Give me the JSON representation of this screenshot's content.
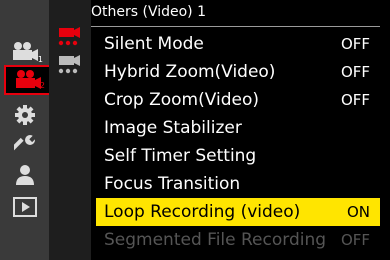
{
  "header": {
    "title": "Others (Video) 1"
  },
  "main_tabs": [
    {
      "name": "video-camera-icon",
      "sub": "1"
    },
    {
      "name": "video-camera-icon",
      "sub": "2"
    },
    {
      "name": "gear-icon"
    },
    {
      "name": "wrench-icon"
    },
    {
      "name": "person-icon"
    },
    {
      "name": "playback-icon"
    }
  ],
  "menu": {
    "items": [
      {
        "label": "Silent Mode",
        "value": "OFF"
      },
      {
        "label": "Hybrid Zoom(Video)",
        "value": "OFF"
      },
      {
        "label": "Crop Zoom(Video)",
        "value": "OFF"
      },
      {
        "label": "Image Stabilizer",
        "value": ""
      },
      {
        "label": "Self Timer Setting",
        "value": ""
      },
      {
        "label": "Focus Transition",
        "value": ""
      },
      {
        "label": "Loop Recording (video)",
        "value": "ON"
      },
      {
        "label": "Segmented File Recording",
        "value": "OFF"
      }
    ]
  },
  "colors": {
    "accent": "#e8000d",
    "highlight": "#ffe500"
  }
}
